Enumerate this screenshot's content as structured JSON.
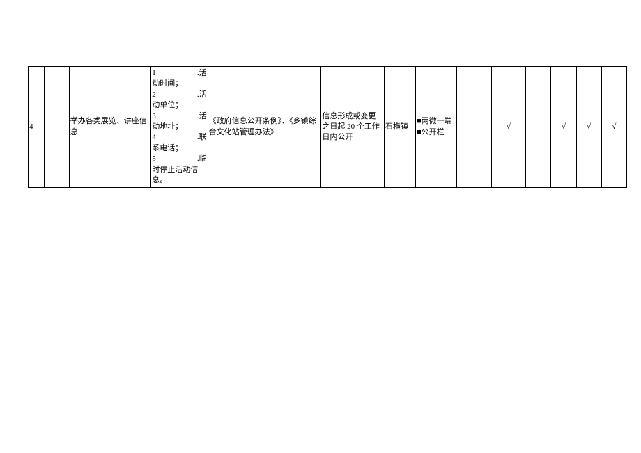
{
  "row": {
    "no": "4",
    "blank": "",
    "item": "举办各类展览、讲座信息",
    "content": {
      "l1n": "1",
      "l1t": ".活",
      "l1b": "动时间；",
      "l2n": "2",
      "l2t": ".活",
      "l2b": "动单位；",
      "l3n": "3",
      "l3t": ".活",
      "l3b": "动地址；",
      "l4n": "4",
      "l4t": ".联",
      "l4b": "系电话；",
      "l5n": "5",
      "l5t": ".临",
      "l5b": "时停止活动信息。"
    },
    "basis": "《政府信息公开条例》、《乡镇综合文化站管理办法》",
    "timing": "信息形成或变更之日起 20 个工作日内公开",
    "subject": "石横镇",
    "channel1": "■两微一端",
    "channel2": "■公开栏",
    "c9": "",
    "c10": "√",
    "c11": "",
    "c12": "√",
    "c13": "√",
    "c14": "√"
  }
}
